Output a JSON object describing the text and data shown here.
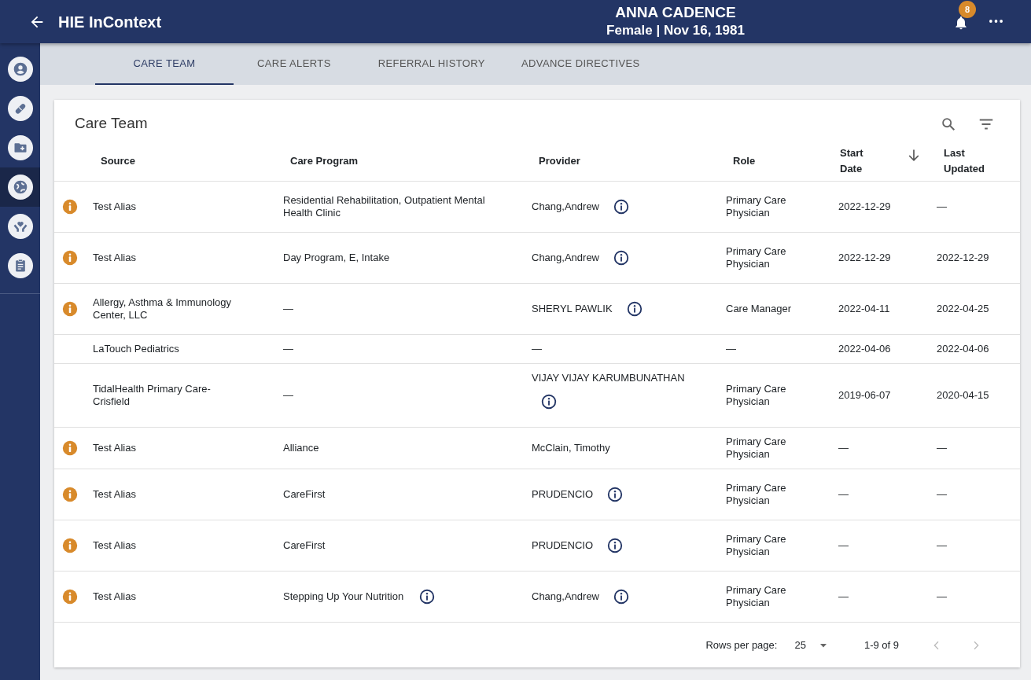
{
  "app": {
    "title": "HIE InContext"
  },
  "patient": {
    "name": "ANNA CADENCE",
    "details": "Female | Nov 16, 1981"
  },
  "notifications": {
    "count": "8"
  },
  "sidebar": {
    "items": [
      {
        "selected": false
      },
      {
        "selected": false
      },
      {
        "selected": false
      },
      {
        "selected": true
      },
      {
        "selected": false
      },
      {
        "selected": false
      }
    ]
  },
  "tabs": [
    {
      "label": "CARE TEAM",
      "selected": true
    },
    {
      "label": "CARE ALERTS",
      "selected": false
    },
    {
      "label": "REFERRAL HISTORY",
      "selected": false
    },
    {
      "label": "ADVANCE DIRECTIVES",
      "selected": false
    }
  ],
  "card": {
    "title": "Care Team"
  },
  "table": {
    "columns": [
      {
        "label": "Source",
        "sorted": false
      },
      {
        "label": "Care Program",
        "sorted": false
      },
      {
        "label": "Provider",
        "sorted": false
      },
      {
        "label": "Role",
        "sorted": false
      },
      {
        "label": "Start Date",
        "sorted": true
      },
      {
        "label": "Last Updated",
        "sorted": false
      }
    ],
    "rows": [
      {
        "alert": true,
        "source": "Test Alias",
        "program": "Residential Rehabilitation, Outpatient Mental Health Clinic",
        "program_info": false,
        "provider": "Chang,Andrew",
        "provider_info": true,
        "role": "Primary Care Physician",
        "start_date": "2022-12-29",
        "last_updated": "—"
      },
      {
        "alert": true,
        "source": "Test Alias",
        "program": "Day Program, E, Intake",
        "program_info": false,
        "provider": "Chang,Andrew",
        "provider_info": true,
        "role": "Primary Care Physician",
        "start_date": "2022-12-29",
        "last_updated": "2022-12-29"
      },
      {
        "alert": true,
        "source": "Allergy, Asthma & Immunology Center, LLC",
        "program": "—",
        "program_info": false,
        "provider": "SHERYL PAWLIK",
        "provider_info": true,
        "role": "Care Manager",
        "start_date": "2022-04-11",
        "last_updated": "2022-04-25"
      },
      {
        "alert": false,
        "source": "LaTouch Pediatrics",
        "program": "—",
        "program_info": false,
        "provider": "—",
        "provider_info": false,
        "role": "—",
        "start_date": "2022-04-06",
        "last_updated": "2022-04-06"
      },
      {
        "alert": false,
        "source": "TidalHealth Primary Care- Crisfield",
        "program": "—",
        "program_info": false,
        "provider": "VIJAY VIJAY KARUMBUNATHAN",
        "provider_info": true,
        "role": "Primary Care Physician",
        "start_date": "2019-06-07",
        "last_updated": "2020-04-15"
      },
      {
        "alert": true,
        "source": "Test Alias",
        "program": "Alliance",
        "program_info": false,
        "provider": "McClain, Timothy",
        "provider_info": false,
        "role": "Primary Care Physician",
        "start_date": "—",
        "last_updated": "—"
      },
      {
        "alert": true,
        "source": "Test Alias",
        "program": "CareFirst",
        "program_info": false,
        "provider": "PRUDENCIO",
        "provider_info": true,
        "role": "Primary Care Physician",
        "start_date": "—",
        "last_updated": "—"
      },
      {
        "alert": true,
        "source": "Test Alias",
        "program": "CareFirst",
        "program_info": false,
        "provider": "PRUDENCIO",
        "provider_info": true,
        "role": "Primary Care Physician",
        "start_date": "—",
        "last_updated": "—"
      },
      {
        "alert": true,
        "source": "Test Alias",
        "program": "Stepping Up Your Nutrition",
        "program_info": true,
        "provider": "Chang,Andrew",
        "provider_info": true,
        "role": "Primary Care Physician",
        "start_date": "—",
        "last_updated": "—"
      }
    ]
  },
  "pagination": {
    "rows_label": "Rows per page:",
    "rows_value": "25",
    "range": "1-9 of 9",
    "prev_disabled": true,
    "next_disabled": true
  }
}
